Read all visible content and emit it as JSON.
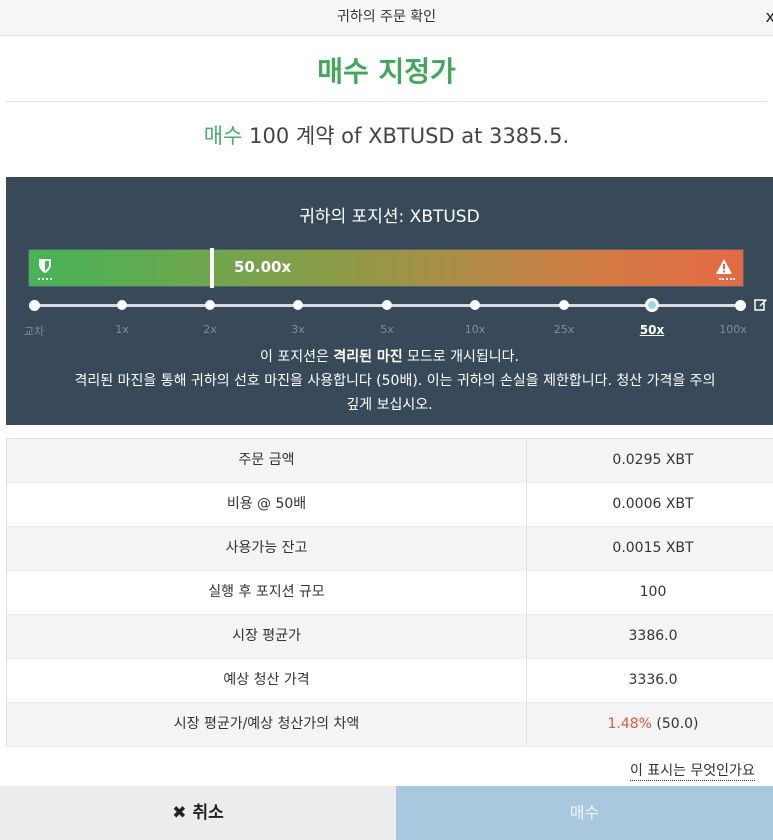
{
  "window": {
    "title": "귀하의 주문 확인",
    "close_glyph": "x"
  },
  "order": {
    "heading": "매수 지정가",
    "summary_side": "매수",
    "summary_text": " 100 계약 of XBTUSD at 3385.5."
  },
  "position_panel": {
    "title": "귀하의 포지션: XBTUSD",
    "leverage_value": "50.00x",
    "leverage_fill_fraction": 0.25,
    "shield_icon": "shield-icon",
    "warning_icon": "warning-icon",
    "slider_labels": [
      "교차",
      "1x",
      "2x",
      "3x",
      "5x",
      "10x",
      "25x",
      "50x",
      "100x"
    ],
    "selected_leverage": "50x",
    "line1_prefix": "이 포지션은 ",
    "line1_bold": "격리된 마진",
    "line1_suffix": " 모드로 개시됩니다.",
    "line2": "격리된 마진을 통해 귀하의 선호 마진을 사용합니다 (50배). 이는 귀하의 손실을 제한합니다. 청산 가격을 주의",
    "line3": "깊게 보십시오."
  },
  "table": {
    "rows": [
      {
        "label": "주문 금액",
        "value": "0.0295 XBT"
      },
      {
        "label": "비용 @ 50배",
        "value": "0.0006 XBT"
      },
      {
        "label": "사용가능 잔고",
        "value": "0.0015 XBT"
      },
      {
        "label": "실행 후 포지션 규모",
        "value": "100"
      },
      {
        "label": "시장 평균가",
        "value": "3386.0"
      },
      {
        "label": "예상 청산 가격",
        "value": "3336.0"
      }
    ],
    "last_row": {
      "label": "시장 평균가/예상 청산가의 차액",
      "pct": "1.48%",
      "abs": " (50.0)"
    }
  },
  "help_link": "이 표시는 무엇인가요",
  "buttons": {
    "cancel_icon": "✖",
    "cancel_label": "취소",
    "buy_label": "매수"
  },
  "colors": {
    "buy_green": "#3fa85b",
    "panel_bg": "#384a5a",
    "pct_red": "#e0573e",
    "buy_button": "#a9c7dd"
  }
}
